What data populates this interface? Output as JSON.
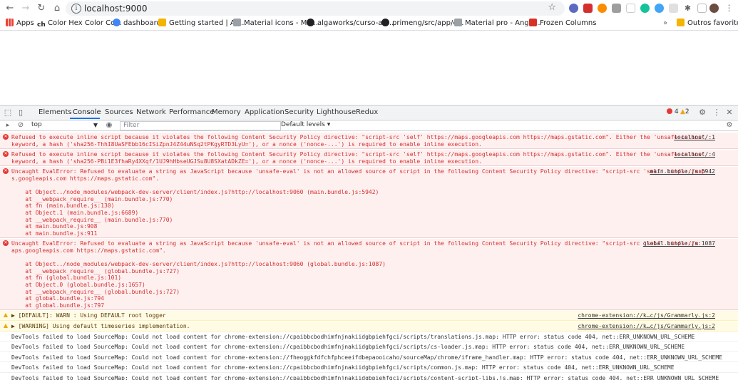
{
  "browser": {
    "url": "localhost:9000",
    "bookmarks": [
      {
        "label": "Apps",
        "color": "#ea4335"
      },
      {
        "label": "Color Hex Color Co...",
        "color": "#202124"
      },
      {
        "label": "dashboard",
        "color": "#4285f4"
      },
      {
        "label": "Getting started | An...",
        "color": "#f4b400"
      },
      {
        "label": "Material icons - Ma...",
        "color": "#9aa0a6"
      },
      {
        "label": "algaworks/curso-an...",
        "color": "#202124"
      },
      {
        "label": "primeng/src/app/c...",
        "color": "#202124"
      },
      {
        "label": "Material pro - Angu...",
        "color": "#9aa0a6"
      },
      {
        "label": "Frozen Columns",
        "color": "#d93025"
      }
    ],
    "other_bookmarks": "Outros favoritos",
    "more": "»"
  },
  "devtools": {
    "tabs": [
      "Elements",
      "Console",
      "Sources",
      "Network",
      "Performance",
      "Memory",
      "Application",
      "Security",
      "Lighthouse",
      "Redux"
    ],
    "active_tab": "Console",
    "error_count": "4",
    "warning_count": "2",
    "context": "top",
    "filter_placeholder": "Filter",
    "levels": "Default levels"
  },
  "console": {
    "messages": [
      {
        "type": "error",
        "lines": [
          "Refused to execute inline script because it violates the following Content Security Policy directive: \"script-src 'self' https://maps.googleapis.com https://maps.gstatic.com\". Either the 'unsafe-inline'",
          "keyword, a hash ('sha256-ThhI8UaSFEbb16cISiZpnJ4Z44uNSq2tPKgyRTD3LyU='), or a nonce ('nonce-...') is required to enable inline execution."
        ],
        "source": "localhost/:1"
      },
      {
        "type": "error",
        "lines": [
          "Refused to execute inline script because it violates the following Content Security Policy directive: \"script-src 'self' https://maps.googleapis.com https://maps.gstatic.com\". Either the 'unsafe-inline'",
          "keyword, a hash ('sha256-PBi1E3fhaRy4XXqf/1UJ9hHbseUGJSu8U8SXatADkZE='), or a nonce ('nonce-...') is required to enable inline execution."
        ],
        "source": "localhost/:4"
      },
      {
        "type": "error",
        "lines": [
          "Uncaught EvalError: Refused to evaluate a string as JavaScript because 'unsafe-eval' is not an allowed source of script in the following Content Security Policy directive: \"script-src 'self' https://map",
          "s.googleapis.com https://maps.gstatic.com\".",
          "",
          "    at Object../node_modules/webpack-dev-server/client/index.js?http://localhost:9060 (main.bundle.js:5942)",
          "    at __webpack_require__ (main.bundle.js:770)",
          "    at fn (main.bundle.js:130)",
          "    at Object.1 (main.bundle.js:6689)",
          "    at __webpack_require__ (main.bundle.js:770)",
          "    at main.bundle.js:908",
          "    at main.bundle.js:911"
        ],
        "source": "main.bundle.js:5942"
      },
      {
        "type": "error",
        "lines": [
          "Uncaught EvalError: Refused to evaluate a string as JavaScript because 'unsafe-eval' is not an allowed source of script in the following Content Security Policy directive: \"script-src 'self' https://m",
          "aps.googleapis.com https://maps.gstatic.com\".",
          "",
          "    at Object../node_modules/webpack-dev-server/client/index.js?http://localhost:9060 (global.bundle.js:1087)",
          "    at __webpack_require__ (global.bundle.js:727)",
          "    at fn (global.bundle.js:101)",
          "    at Object.0 (global.bundle.js:1657)",
          "    at __webpack_require__ (global.bundle.js:727)",
          "    at global.bundle.js:794",
          "    at global.bundle.js:797"
        ],
        "source": "global.bundle.js:1087"
      },
      {
        "type": "warn",
        "lines": [
          "▶ [DEFAULT]: WARN : Using DEFAULT root logger"
        ],
        "source": "chrome-extension://k…c/js/Grammarly.js:2"
      },
      {
        "type": "warn",
        "lines": [
          "▶ [WARNING] Using default timeseries implementation."
        ],
        "source": "chrome-extension://k…c/js/Grammarly.js:2"
      },
      {
        "type": "info",
        "lines": [
          "DevTools failed to load SourceMap: Could not load content for chrome-extension://cpaibbcbodhimfnjnakiidgbpiehfgci/scripts/translations.js.map: HTTP error: status code 404, net::ERR_UNKNOWN_URL_SCHEME"
        ],
        "source": ""
      },
      {
        "type": "info",
        "lines": [
          "DevTools failed to load SourceMap: Could not load content for chrome-extension://cpaibbcbodhimfnjnakiidgbpiehfgci/scripts/cs-loader.js.map: HTTP error: status code 404, net::ERR_UNKNOWN_URL_SCHEME"
        ],
        "source": ""
      },
      {
        "type": "info",
        "lines": [
          "DevTools failed to load SourceMap: Could not load content for chrome-extension://fheoggkfdfchfphceeifdbepaooicaho/sourceMap/chrome/iframe_handler.map: HTTP error: status code 404, net::ERR_UNKNOWN_URL_SCHEME"
        ],
        "source": ""
      },
      {
        "type": "info",
        "lines": [
          "DevTools failed to load SourceMap: Could not load content for chrome-extension://cpaibbcbodhimfnjnakiidgbpiehfgci/scripts/common.js.map: HTTP error: status code 404, net::ERR_UNKNOWN_URL_SCHEME"
        ],
        "source": ""
      },
      {
        "type": "info",
        "lines": [
          "DevTools failed to load SourceMap: Could not load content for chrome-extension://cpaibbcbodhimfnjnakiidgbpiehfgci/scripts/content-script-libs.js.map: HTTP error: status code 404, net::ERR_UNKNOWN_URL_SCHEME"
        ],
        "source": ""
      }
    ]
  }
}
